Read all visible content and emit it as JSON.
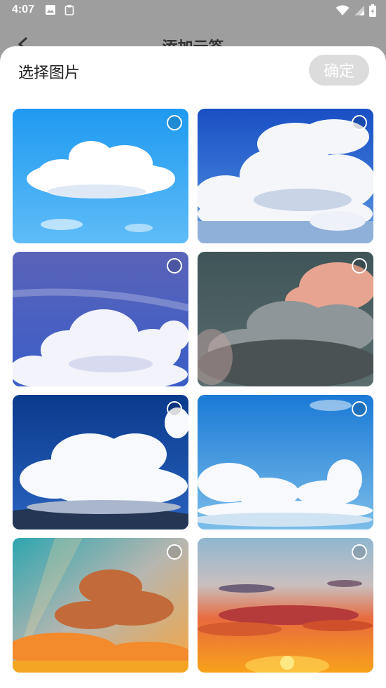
{
  "status_bar": {
    "time": "4:07",
    "left_icons": [
      "image-icon",
      "clipboard-icon"
    ],
    "right_icons": [
      "wifi-icon",
      "signal-icon",
      "battery-icon"
    ]
  },
  "background_page": {
    "title": "添加云签",
    "back_icon": "back-arrow-icon"
  },
  "picker": {
    "title": "选择图片",
    "confirm_label": "确定",
    "confirm_color": "#dcdcdc",
    "images": [
      {
        "name": "clear-sky-cloud",
        "selected": false
      },
      {
        "name": "cumulus-deep-blue",
        "selected": false
      },
      {
        "name": "purple-blue-sky-clouds",
        "selected": false
      },
      {
        "name": "storm-cloud-pink-edge",
        "selected": false
      },
      {
        "name": "dark-blue-big-cumulus",
        "selected": false
      },
      {
        "name": "blue-sky-horizon-clouds",
        "selected": false
      },
      {
        "name": "orange-sunrays-clouds",
        "selected": false
      },
      {
        "name": "sunset-orange-horizon",
        "selected": false
      }
    ]
  }
}
